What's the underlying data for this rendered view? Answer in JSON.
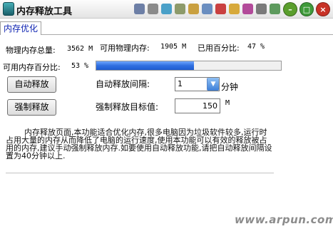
{
  "window": {
    "title": "内存释放工具",
    "minimize_glyph": "–",
    "maximize_glyph": "□",
    "close_glyph": "×"
  },
  "toolbar_icons": [
    {
      "name": "toolbar-icon-1",
      "color": "#6d7fa6"
    },
    {
      "name": "toolbar-icon-2",
      "color": "#8a8a8a"
    },
    {
      "name": "toolbar-icon-3",
      "color": "#4aa0c8"
    },
    {
      "name": "toolbar-icon-4",
      "color": "#8d9a6a"
    },
    {
      "name": "toolbar-icon-5",
      "color": "#c9a040"
    },
    {
      "name": "toolbar-icon-6",
      "color": "#6a8ec0"
    },
    {
      "name": "toolbar-icon-7",
      "color": "#c94040"
    },
    {
      "name": "toolbar-icon-8",
      "color": "#d7a93a"
    },
    {
      "name": "toolbar-icon-9",
      "color": "#b24a9a"
    },
    {
      "name": "toolbar-icon-10",
      "color": "#7a7a7a"
    },
    {
      "name": "toolbar-icon-11",
      "color": "#5d9a5d"
    }
  ],
  "tabs": [
    {
      "label": "内存优化"
    }
  ],
  "memory": {
    "total_label": "物理内存总量:",
    "total_value": "3562 M",
    "available_label": "可用物理内存:",
    "available_value": "1905 M",
    "used_pct_label": "已用百分比:",
    "used_pct_value": "47 %",
    "available_pct_label": "可用内存百分比:",
    "available_pct_value": "53 %",
    "available_pct_fraction": 0.53
  },
  "auto_release": {
    "button_label": "自动释放",
    "interval_label": "自动释放间隔:",
    "interval_value": "1",
    "interval_unit": "分钟"
  },
  "force_release": {
    "button_label": "强制释放",
    "target_label": "强制释放目标值:",
    "target_value": "150",
    "target_unit": "M"
  },
  "description": "内存释放页面,本功能适合优化内存,很多电脑因为垃圾软件较多,运行时占用大量的内存从而降低了电脑的运行速度,使用本功能可以有效的释放被占用的内存,建议手动强制释放内存.如要使用自动释放功能,请把自动释放间隔设置为40分钟以上.",
  "watermark": "www.arpun.com",
  "colors": {
    "accent": "#2f6fe0",
    "tab_text": "#0a1fb0",
    "min_button": "#5a9e2c",
    "max_button": "#3f9a3a",
    "close_button": "#c83226"
  }
}
